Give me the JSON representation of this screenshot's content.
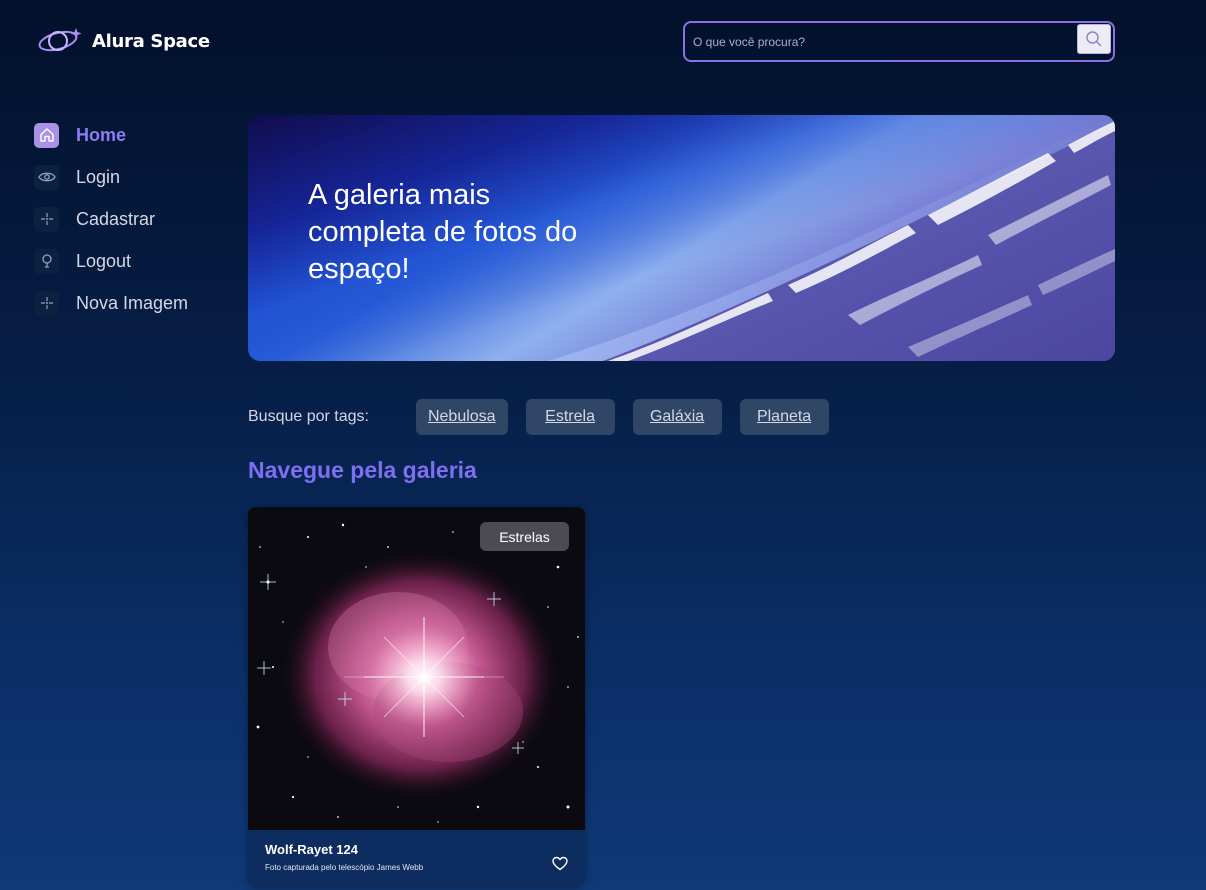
{
  "header": {
    "logo_text": "Alura Space",
    "search": {
      "placeholder": "O que você procura?"
    }
  },
  "sidebar": {
    "items": [
      {
        "label": "Home",
        "icon": "home-icon",
        "active": true
      },
      {
        "label": "Login",
        "icon": "eye-icon",
        "active": false
      },
      {
        "label": "Cadastrar",
        "icon": "sparkle-icon",
        "active": false
      },
      {
        "label": "Logout",
        "icon": "bulb-icon",
        "active": false
      },
      {
        "label": "Nova Imagem",
        "icon": "sparkle-icon",
        "active": false
      }
    ]
  },
  "banner": {
    "title": "A galeria mais completa de fotos do espaço!"
  },
  "tags": {
    "label": "Busque por tags:",
    "items": [
      "Nebulosa",
      "Estrela",
      "Galáxia",
      "Planeta"
    ]
  },
  "gallery": {
    "title": "Navegue pela galeria",
    "cards": [
      {
        "badge": "Estrelas",
        "title": "Wolf-Rayet 124",
        "subtitle": "Foto capturada pelo telescópio James Webb",
        "icon": "heart-icon"
      }
    ]
  },
  "colors": {
    "accent": "#8d7df0",
    "search_border": "#8d6fe6",
    "tag_bg": "#304666",
    "home_icon_bg": "#a991e6"
  }
}
